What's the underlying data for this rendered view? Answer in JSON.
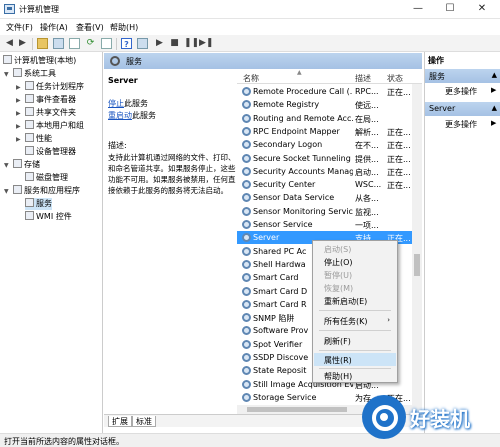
{
  "window": {
    "title": "计算机管理",
    "min": "—",
    "max": "☐",
    "close": "✕"
  },
  "menu": [
    {
      "label": "文件(F)"
    },
    {
      "label": "操作(A)"
    },
    {
      "label": "查看(V)"
    },
    {
      "label": "帮助(H)"
    }
  ],
  "tree": [
    {
      "label": "计算机管理(本地)",
      "icon": "computer-icon"
    },
    {
      "label": "系统工具",
      "icon": "tools-icon"
    },
    {
      "label": "任务计划程序",
      "icon": "clock-icon"
    },
    {
      "label": "事件查看器",
      "icon": "event-viewer-icon"
    },
    {
      "label": "共享文件夹",
      "icon": "shared-folder-icon"
    },
    {
      "label": "本地用户和组",
      "icon": "users-icon"
    },
    {
      "label": "性能",
      "icon": "performance-icon"
    },
    {
      "label": "设备管理器",
      "icon": "device-manager-icon"
    },
    {
      "label": "存储",
      "icon": "storage-icon"
    },
    {
      "label": "磁盘管理",
      "icon": "disk-icon"
    },
    {
      "label": "服务和应用程序",
      "icon": "services-apps-icon"
    },
    {
      "label": "服务",
      "icon": "services-icon",
      "selected": true
    },
    {
      "label": "WMI 控件",
      "icon": "wmi-icon"
    }
  ],
  "center": {
    "header": "服务",
    "service_name": "Server",
    "stop_link": "停止",
    "stop_suffix": "此服务",
    "restart_link": "重启动",
    "restart_suffix": "此服务",
    "desc_label": "描述:",
    "desc_text": "支持此计算机通过网络的文件、打印、和命名管道共享。如果服务停止，这些功能不可用。如果服务被禁用，任何直接依赖于此服务的服务将无法启动。"
  },
  "columns": {
    "name": "名称",
    "desc": "描述",
    "status": "状态"
  },
  "services": [
    {
      "name": "Remote Procedure Call (...",
      "desc": "RPC...",
      "status": "正在..."
    },
    {
      "name": "Remote Registry",
      "desc": "使远...",
      "status": ""
    },
    {
      "name": "Routing and Remote Acc...",
      "desc": "在局...",
      "status": ""
    },
    {
      "name": "RPC Endpoint Mapper",
      "desc": "解析...",
      "status": "正在..."
    },
    {
      "name": "Secondary Logon",
      "desc": "在不...",
      "status": "正在..."
    },
    {
      "name": "Secure Socket Tunneling ...",
      "desc": "提供...",
      "status": "正在..."
    },
    {
      "name": "Security Accounts Manag...",
      "desc": "启动...",
      "status": "正在..."
    },
    {
      "name": "Security Center",
      "desc": "WSC...",
      "status": "正在..."
    },
    {
      "name": "Sensor Data Service",
      "desc": "从各...",
      "status": ""
    },
    {
      "name": "Sensor Monitoring Service",
      "desc": "监视...",
      "status": ""
    },
    {
      "name": "Sensor Service",
      "desc": "一项...",
      "status": ""
    },
    {
      "name": "Server",
      "desc": "支持...",
      "status": "正在...",
      "selected": true
    },
    {
      "name": "Shared PC Ac",
      "desc": "",
      "status": ""
    },
    {
      "name": "Shell Hardwa",
      "desc": "",
      "status": ""
    },
    {
      "name": "Smart Card",
      "desc": "",
      "status": ""
    },
    {
      "name": "Smart Card D",
      "desc": "",
      "status": ""
    },
    {
      "name": "Smart Card R",
      "desc": "",
      "status": ""
    },
    {
      "name": "SNMP 陷阱",
      "desc": "",
      "status": ""
    },
    {
      "name": "Software Prov",
      "desc": "",
      "status": ""
    },
    {
      "name": "Spot Verifier",
      "desc": "",
      "status": ""
    },
    {
      "name": "SSDP Discove",
      "desc": "",
      "status": ""
    },
    {
      "name": "State Reposit",
      "desc": "",
      "status": ""
    },
    {
      "name": "Still Image Acquisition Eve...",
      "desc": "启动...",
      "status": ""
    },
    {
      "name": "Storage Service",
      "desc": "为存...",
      "status": "正在..."
    }
  ],
  "tabs": [
    {
      "label": "扩展"
    },
    {
      "label": "标准"
    }
  ],
  "actions": {
    "header": "操作",
    "group1": "服务",
    "group1_more": "更多操作",
    "group2": "Server",
    "group2_more": "更多操作"
  },
  "context_menu": [
    {
      "label": "启动(S)",
      "disabled": true
    },
    {
      "label": "停止(O)"
    },
    {
      "label": "暂停(U)",
      "disabled": true
    },
    {
      "label": "恢复(M)",
      "disabled": true
    },
    {
      "label": "重新启动(E)"
    },
    {
      "label": "所有任务(K)",
      "submenu": true
    },
    {
      "label": "刷新(F)"
    },
    {
      "label": "属性(R)",
      "highlighted": true
    },
    {
      "label": "帮助(H)"
    }
  ],
  "status_text": "打开当前所选内容的属性对话框。",
  "watermark": "好装机",
  "colors": {
    "selection": "#3399ff",
    "header": "#bcd4ee",
    "link": "#1a55c0"
  }
}
